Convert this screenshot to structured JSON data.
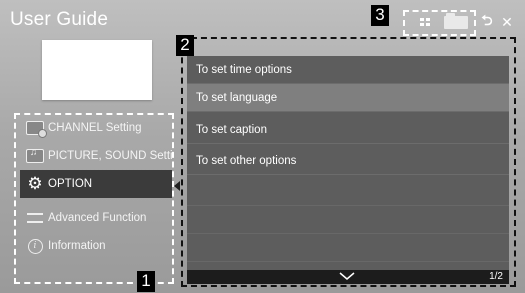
{
  "window": {
    "title": "User Guide"
  },
  "toolbar": {
    "icons": [
      "grid-view-icon",
      "folder-icon",
      "back-icon",
      "close-icon"
    ],
    "back_glyph": "⮌",
    "close_glyph": "✕"
  },
  "sidebar": {
    "items": [
      {
        "label": "CHANNEL Setting",
        "icon": "channel-icon",
        "active": false
      },
      {
        "label": "PICTURE, SOUND Setting",
        "icon": "picture-sound-icon",
        "active": false
      },
      {
        "label": "OPTION",
        "icon": "gear-icon",
        "active": true
      },
      {
        "label": "Advanced Function",
        "icon": "advanced-function-icon",
        "active": false
      },
      {
        "label": "Information",
        "icon": "info-icon",
        "active": false
      }
    ]
  },
  "main": {
    "items": [
      {
        "label": "To set time options",
        "selected": false
      },
      {
        "label": "To set language",
        "selected": true
      },
      {
        "label": "To set caption",
        "selected": false
      },
      {
        "label": "To set other options",
        "selected": false
      }
    ],
    "page_indicator": "1/2"
  },
  "callouts": {
    "one": "1",
    "two": "2",
    "three": "3"
  },
  "colors": {
    "background": "#a9a9a9",
    "panel": "#5d5d5d",
    "active_item": "#3b3b3b",
    "selected_row": "#7f7f7f"
  }
}
